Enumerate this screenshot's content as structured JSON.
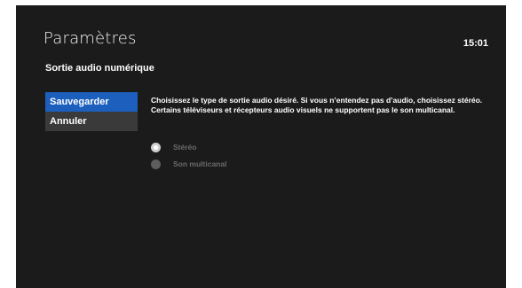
{
  "header": {
    "title": "Paramètres",
    "time": "15:01"
  },
  "page": {
    "subtitle": "Sortie audio numérique",
    "description": "Choisissez le type de sortie audio désiré. Si vous n’entendez pas d’audio, choisissez stéréo. Certains téléviseurs et récepteurs audio visuels ne supportent pas le son multicanal."
  },
  "menu": {
    "items": [
      {
        "label": "Sauvegarder",
        "selected": true
      },
      {
        "label": "Annuler",
        "selected": false
      }
    ]
  },
  "options": [
    {
      "label": "Stéréo",
      "checked": true
    },
    {
      "label": "Son multicanal",
      "checked": false
    }
  ],
  "colors": {
    "background": "#1b1b1b",
    "accent": "#1d5fbd",
    "menu_item": "#3a3a3a",
    "disabled_text": "#6a6a6a"
  }
}
